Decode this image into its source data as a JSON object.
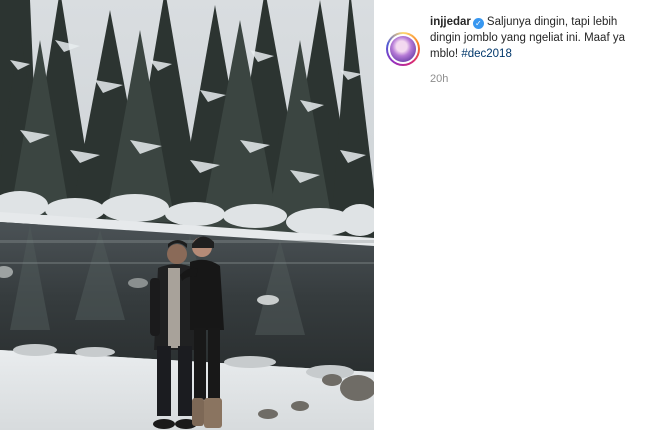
{
  "post": {
    "username": "injjedar",
    "caption": "Saljunya dingin, tapi lebih dingin jomblo yang ngeliat ini. Maaf ya mblo!",
    "hashtag": "#dec2018",
    "time": "20h"
  },
  "icons": {
    "verified": "verified-badge-icon",
    "check": "✓"
  },
  "colors": {
    "verified": "#3897f0",
    "hashtag": "#00376b",
    "time": "#8e8e8e"
  }
}
